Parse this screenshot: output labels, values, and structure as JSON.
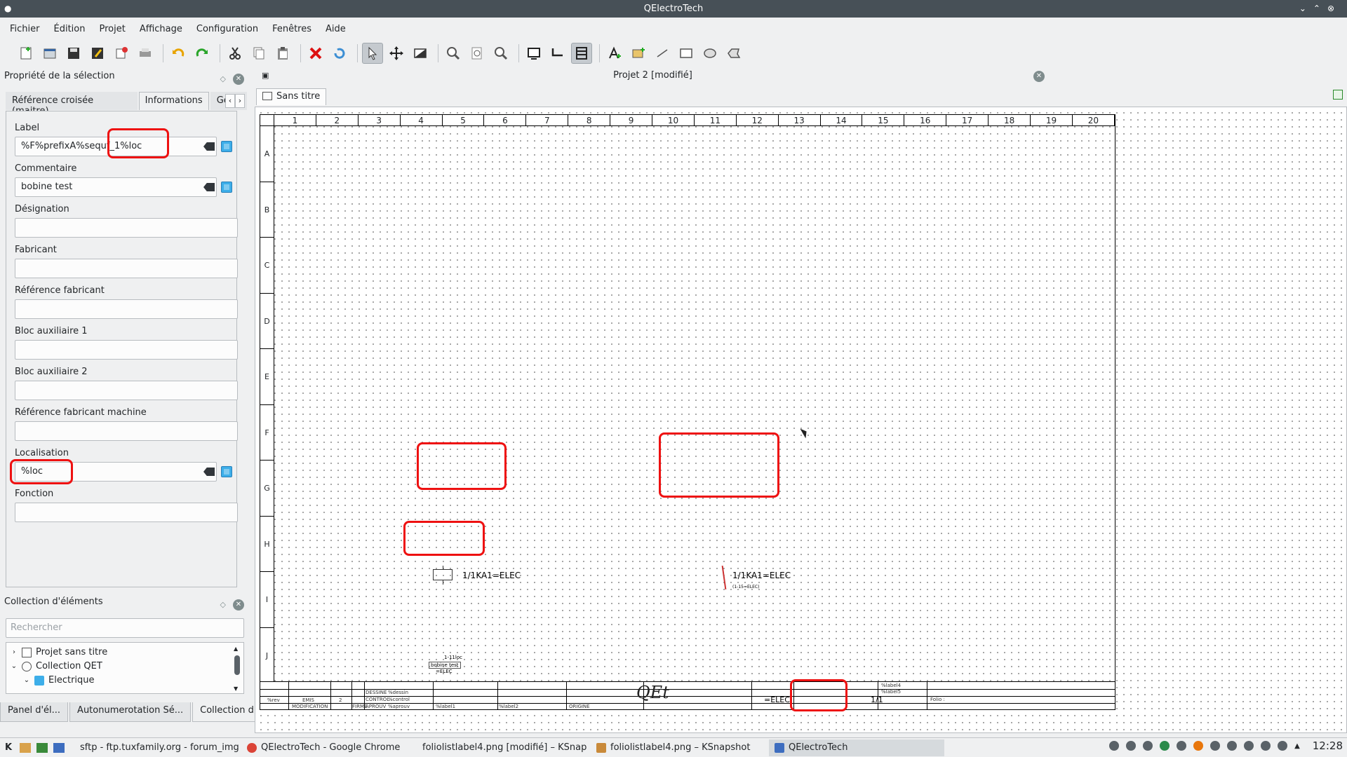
{
  "window": {
    "title": "QElectroTech"
  },
  "menu": [
    "Fichier",
    "Édition",
    "Projet",
    "Affichage",
    "Configuration",
    "Fenêtres",
    "Aide"
  ],
  "properties_panel": {
    "title": "Propriété de la sélection",
    "tabs": [
      "Référence croisée (maitre)",
      "Informations",
      "Géné"
    ],
    "fields": [
      {
        "label": "Label",
        "value": "%F%prefixA%sequf_1%loc"
      },
      {
        "label": "Commentaire",
        "value": "bobine test"
      },
      {
        "label": "Désignation",
        "value": ""
      },
      {
        "label": "Fabricant",
        "value": ""
      },
      {
        "label": "Référence fabricant",
        "value": ""
      },
      {
        "label": "Bloc auxiliaire 1",
        "value": ""
      },
      {
        "label": "Bloc auxiliaire 2",
        "value": ""
      },
      {
        "label": "Référence fabricant machine",
        "value": ""
      },
      {
        "label": "Localisation",
        "value": "%loc"
      },
      {
        "label": "Fonction",
        "value": ""
      }
    ]
  },
  "collection_panel": {
    "title": "Collection d'éléments",
    "search_placeholder": "Rechercher",
    "tree": [
      "Projet sans titre",
      "Collection QET",
      "Electrique"
    ]
  },
  "bottom_tabs": [
    "Panel d'él...",
    "Autonumerotation Sé...",
    "Collection d'él..."
  ],
  "document": {
    "title": "Projet 2 [modifié]",
    "folio_tab": "Sans titre",
    "columns": [
      "1",
      "2",
      "3",
      "4",
      "5",
      "6",
      "7",
      "8",
      "9",
      "10",
      "11",
      "12",
      "13",
      "14",
      "15",
      "16",
      "17",
      "18",
      "19",
      "20"
    ],
    "rows": [
      "A",
      "B",
      "C",
      "D",
      "E",
      "F",
      "G",
      "H",
      "I",
      "J"
    ],
    "elements": {
      "coil_label": "1/1KA1=ELEC",
      "contact_label": "1/1KA1=ELEC",
      "contact_sub": "(1-15=ELEC)",
      "small_ref": "1-11loc",
      "small_comment": "bobine test",
      "small_loc": "=ELEC"
    },
    "cartouche": {
      "loc": "=ELEC",
      "folio": "1/1",
      "rev": "%rev",
      "emis": "EMIS",
      "num": "2",
      "dessine": "DESSINE",
      "control": "CONTROL",
      "approuv": "APROUV",
      "modification": "MODIFICATION",
      "origine": "ORIGINE",
      "firme": "FIRME",
      "dessin_val": "%dessin",
      "control_val": "%control",
      "approuv_val": "%aprouv",
      "label1": "%label1",
      "label2": "%label2",
      "label4": "%label4",
      "label5": "%label5",
      "folio_label": "Folio :"
    }
  },
  "taskbar": {
    "tasks": [
      "sftp - ftp.tuxfamily.org - forum_img",
      "QElectroTech - Google Chrome",
      "foliolistlabel4.png [modifié] – KSnap",
      "foliolistlabel4.png – KSnapshot",
      "QElectroTech"
    ],
    "clock": "12:28"
  }
}
